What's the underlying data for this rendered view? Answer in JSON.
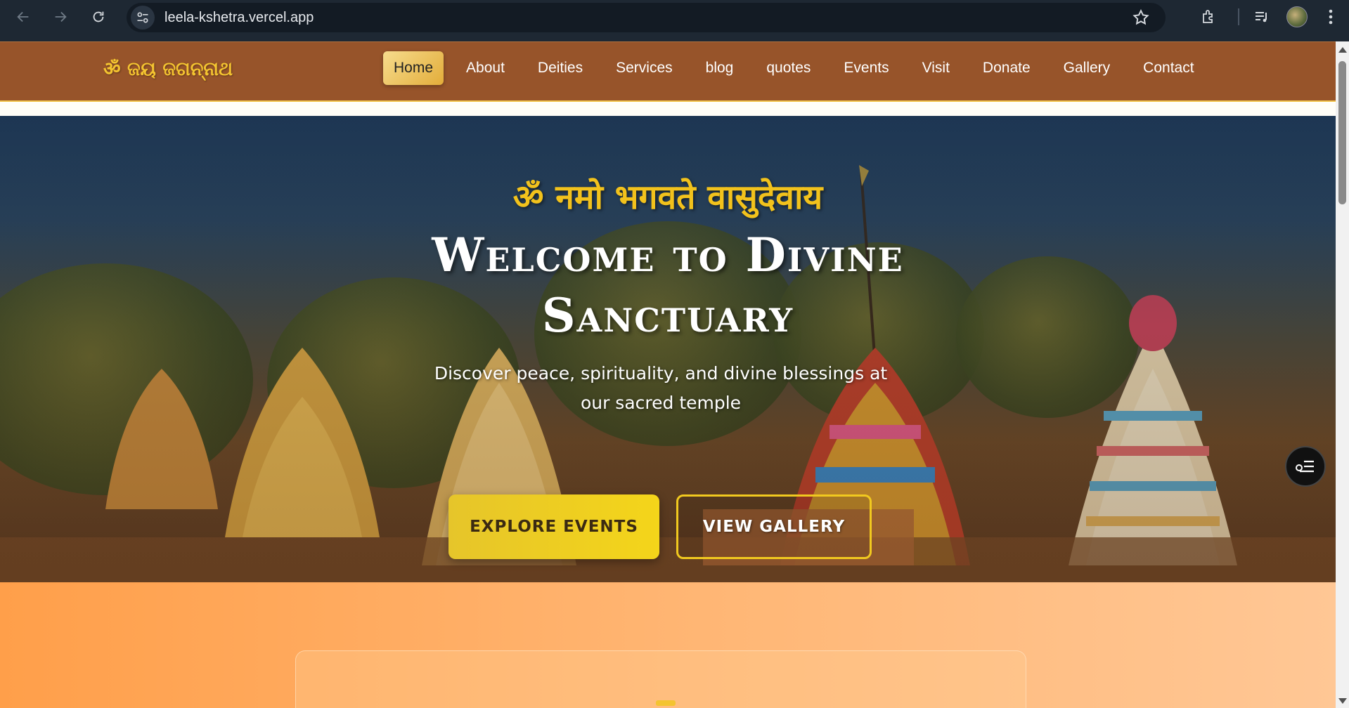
{
  "browser": {
    "url": "leela-kshetra.vercel.app",
    "icons": [
      "back-arrow-icon",
      "forward-arrow-icon",
      "reload-icon",
      "site-info-icon",
      "bookmark-star-icon",
      "extensions-icon",
      "media-controls-icon",
      "profile-avatar",
      "menu-kebab-icon"
    ]
  },
  "navbar": {
    "brand": "ॐ ଜୟ ଜଗନ୍ନାଥ",
    "links": [
      "Home",
      "About",
      "Deities",
      "Services",
      "blog",
      "quotes",
      "Events",
      "Visit",
      "Donate",
      "Gallery",
      "Contact"
    ],
    "active": "Home"
  },
  "hero": {
    "mantra": "ॐ नमो भगवते वासुदेवाय",
    "title_line1": "Welcome to Divine",
    "title_line2": "Sanctuary",
    "subtitle": "Discover peace, spirituality, and divine blessings at our sacred temple",
    "primary_button": "EXPLORE EVENTS",
    "secondary_button": "VIEW GALLERY"
  },
  "colors": {
    "navbar_bg": "#97542a",
    "brand_gold": "#f4c430",
    "button_yellow": "#f4d51a",
    "section_orange": "#ffa552"
  }
}
